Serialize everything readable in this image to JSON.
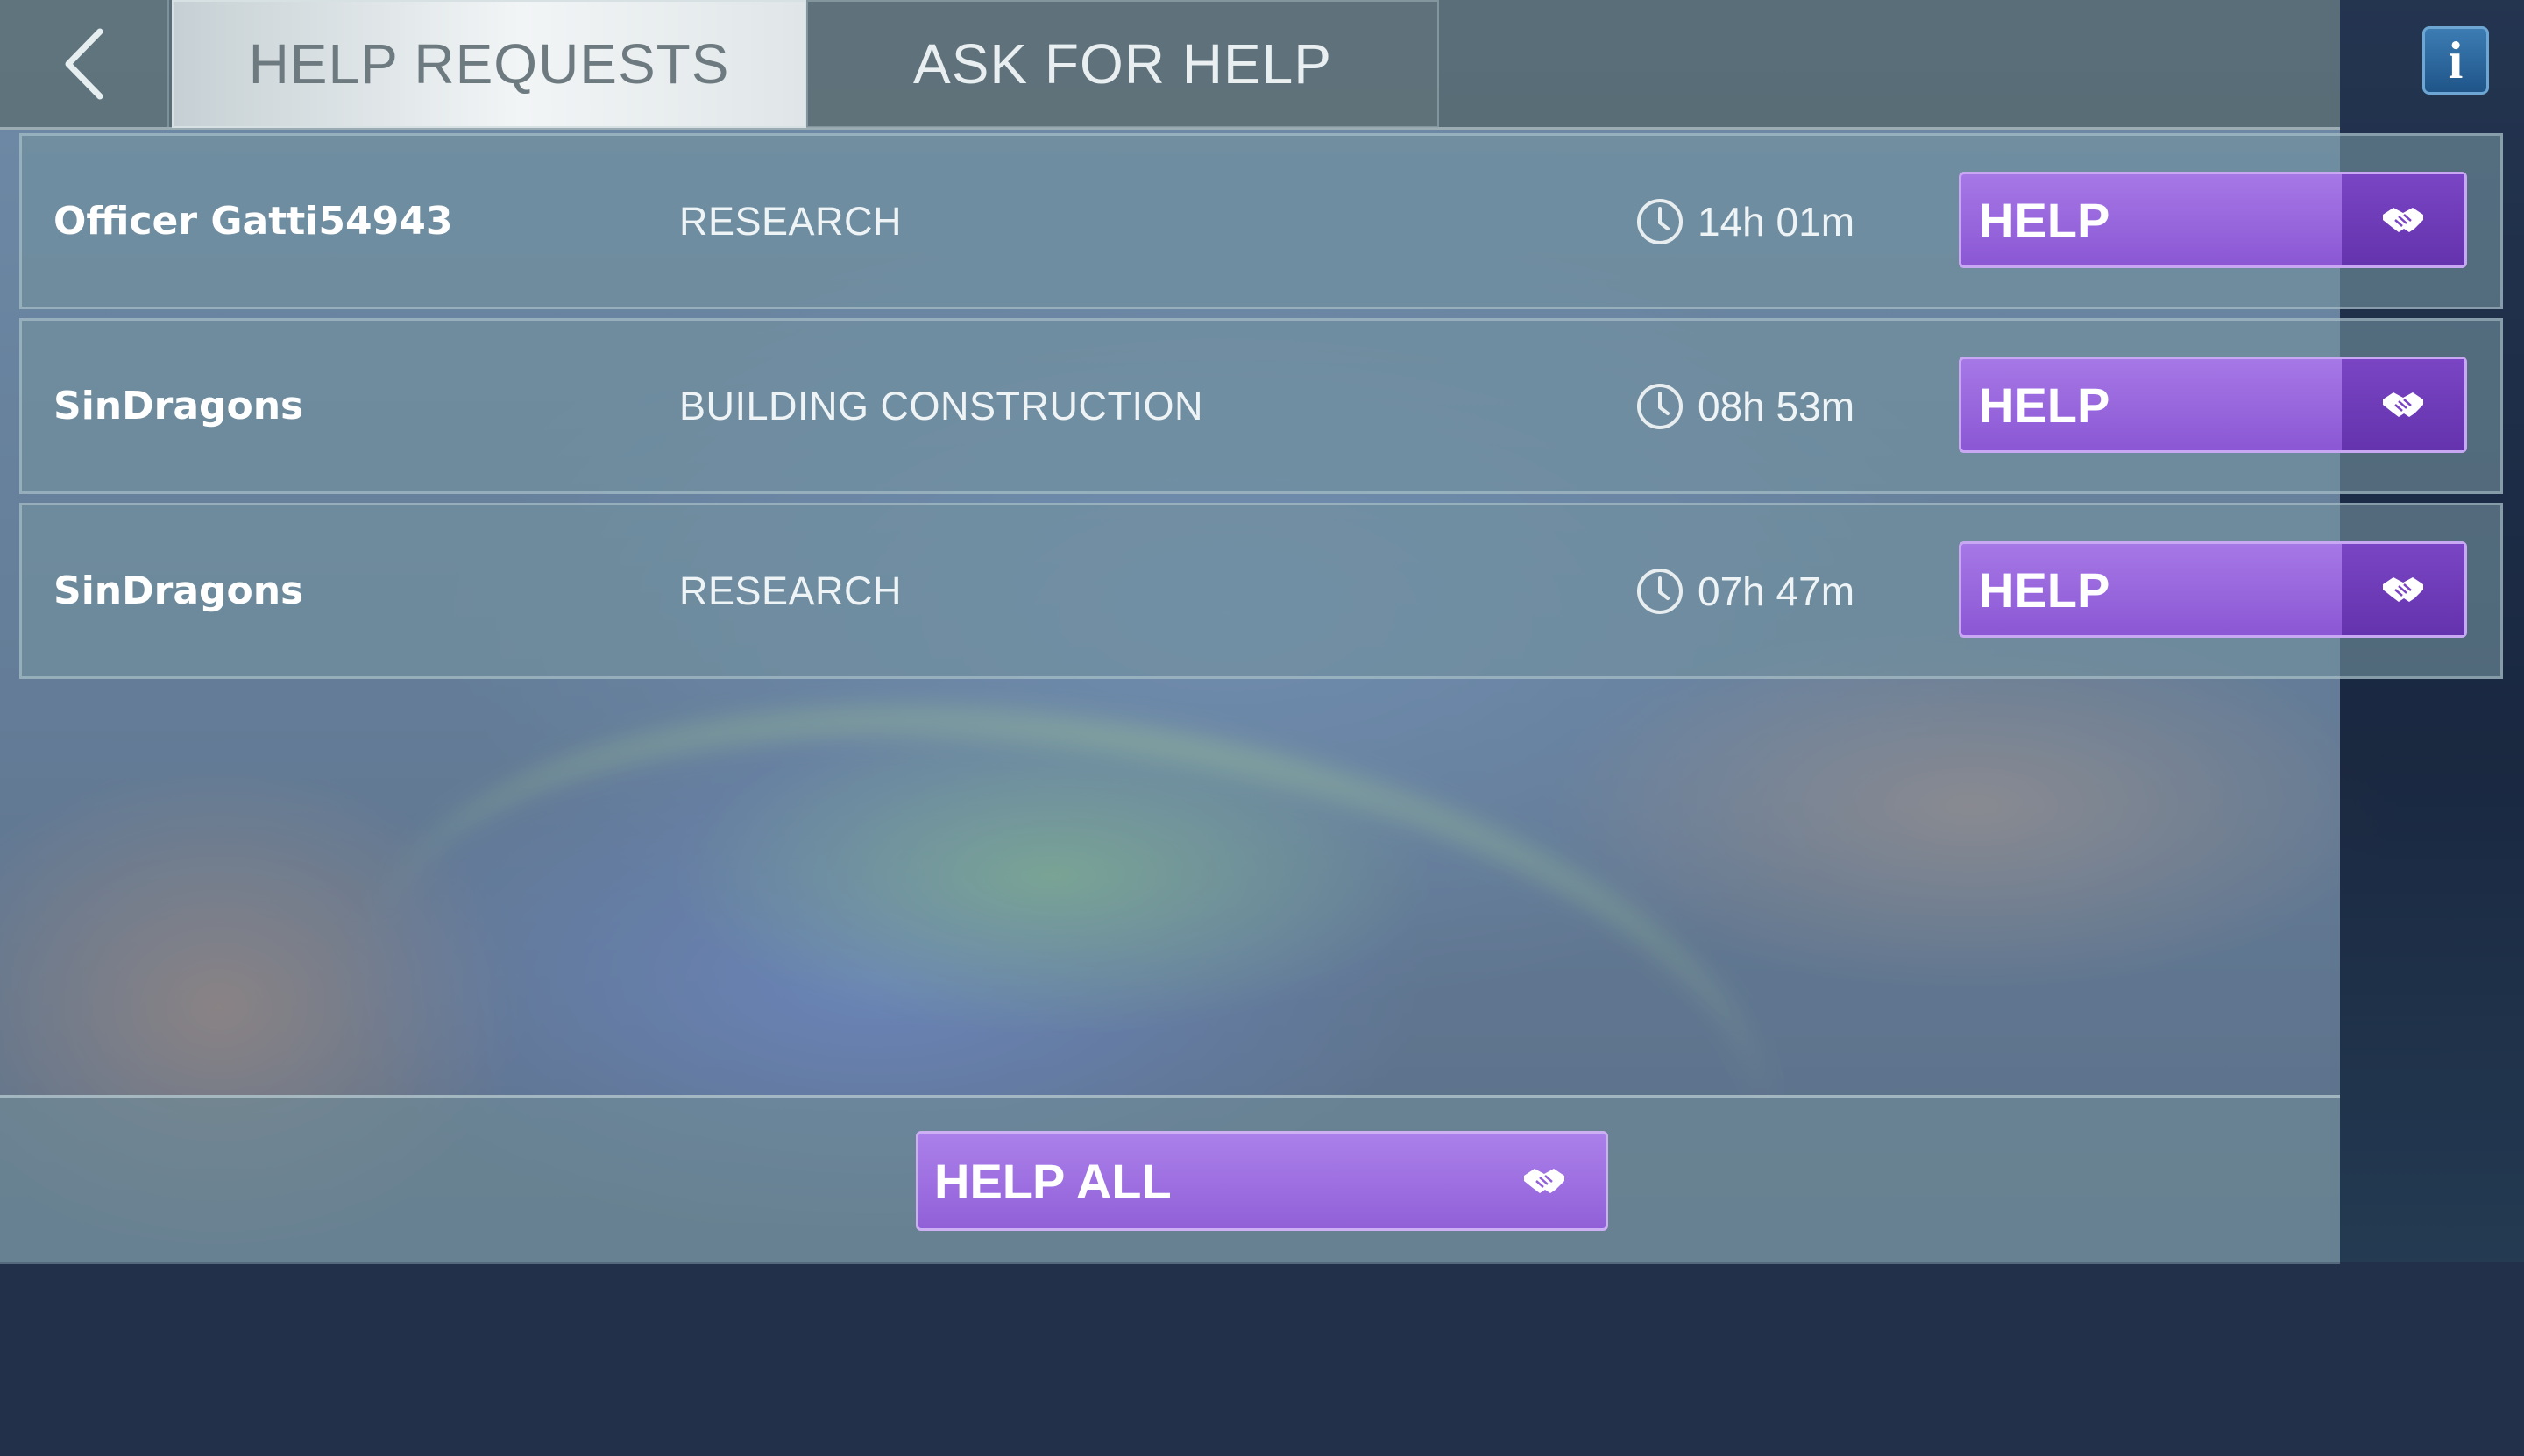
{
  "tabs": {
    "help_requests": "HELP REQUESTS",
    "ask_for_help": "ASK FOR HELP"
  },
  "info_label": "i",
  "requests": [
    {
      "player": "Officer Gatti54943",
      "task": "RESEARCH",
      "time": "14h 01m",
      "button": "HELP"
    },
    {
      "player": "SinDragons",
      "task": "BUILDING CONSTRUCTION",
      "time": "08h 53m",
      "button": "HELP"
    },
    {
      "player": "SinDragons",
      "task": "RESEARCH",
      "time": "07h 47m",
      "button": "HELP"
    }
  ],
  "help_all_label": "HELP ALL",
  "icons": {
    "back": "chevron-left-icon",
    "clock": "clock-icon",
    "handshake": "handshake-icon",
    "info": "info-icon"
  },
  "colors": {
    "button_purple": "#9a68dd",
    "button_purple_dark": "#6c3bb4",
    "info_blue": "#2a6aa0"
  }
}
